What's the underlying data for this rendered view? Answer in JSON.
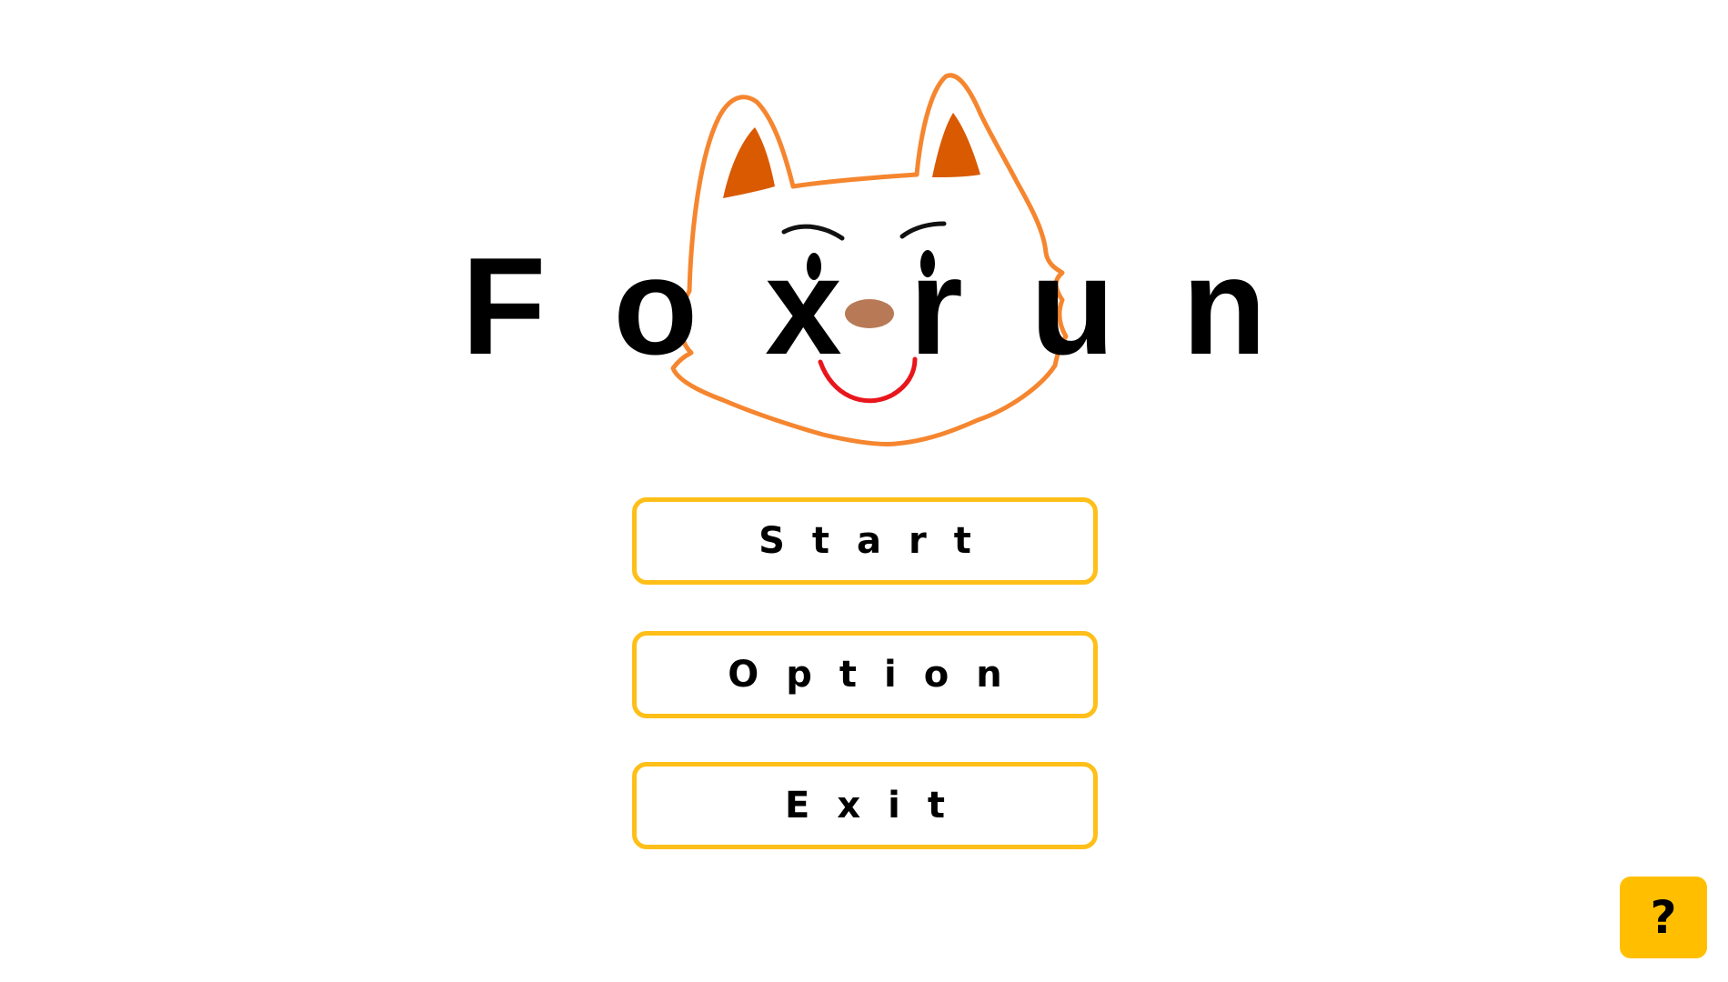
{
  "game": {
    "title": "Foxrun"
  },
  "menu": {
    "start_label": "Start",
    "option_label": "Option",
    "exit_label": "Exit"
  },
  "help": {
    "label": "?"
  },
  "colors": {
    "button_border": "#ffbf19",
    "help_button_fill": "#ffbf00",
    "fox_outline": "#f5862f",
    "fox_inner_ear": "#d95a00",
    "fox_nose": "#b87a56",
    "fox_mouth": "#e8161c",
    "title_text": "#000000",
    "background": "#ffffff"
  },
  "icons": {
    "help": "question-mark-icon",
    "mascot": "fox-face-icon"
  }
}
